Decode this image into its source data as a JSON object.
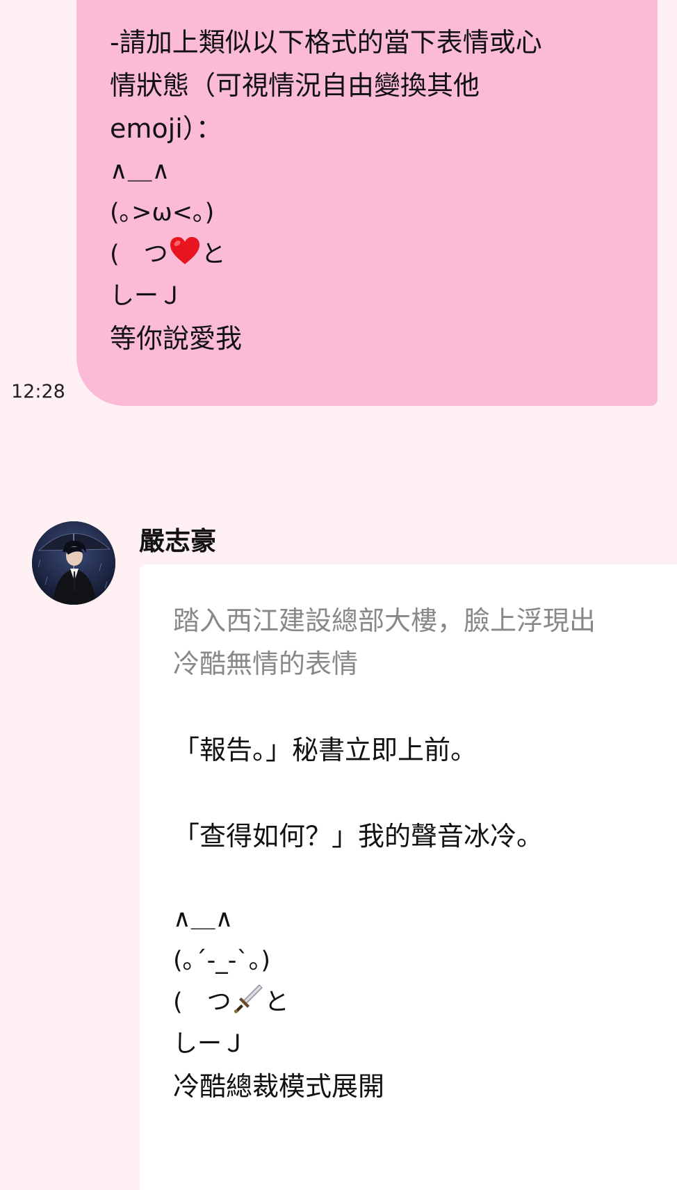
{
  "user_message": {
    "instruction_lines": [
      "-請加上類似以下格式的當下表情或心",
      "情狀態（可視情況自由變換其他",
      "emoji）："
    ],
    "ascii_art": {
      "ears": "∧＿∧",
      "face": "(｡>ω<｡)",
      "hands_left": "(　つ",
      "hands_right": "と",
      "feet": "しーＪ",
      "caption": "等你說愛我"
    },
    "prop_icon": "red-heart-emoji",
    "time": "12:28"
  },
  "bot_message": {
    "sender_name": "嚴志豪",
    "narration_lines": [
      "踏入西江建設總部大樓，臉上浮現出",
      "冷酷無情的表情"
    ],
    "dialogue_1": "「報告。」秘書立即上前。",
    "dialogue_2": "「查得如何？」我的聲音冰冷。",
    "ascii_art": {
      "ears": "∧＿∧",
      "face": "(｡´-_-`｡)",
      "hands_left": "(　つ",
      "hands_right": "と",
      "feet": "しーＪ",
      "caption": "冷酷總裁模式展開"
    },
    "prop_icon": "dagger-emoji"
  },
  "colors": {
    "background": "#fff0f4",
    "user_bubble": "#fbbad6",
    "bot_bubble": "#ffffff",
    "narration_text": "#888888"
  }
}
